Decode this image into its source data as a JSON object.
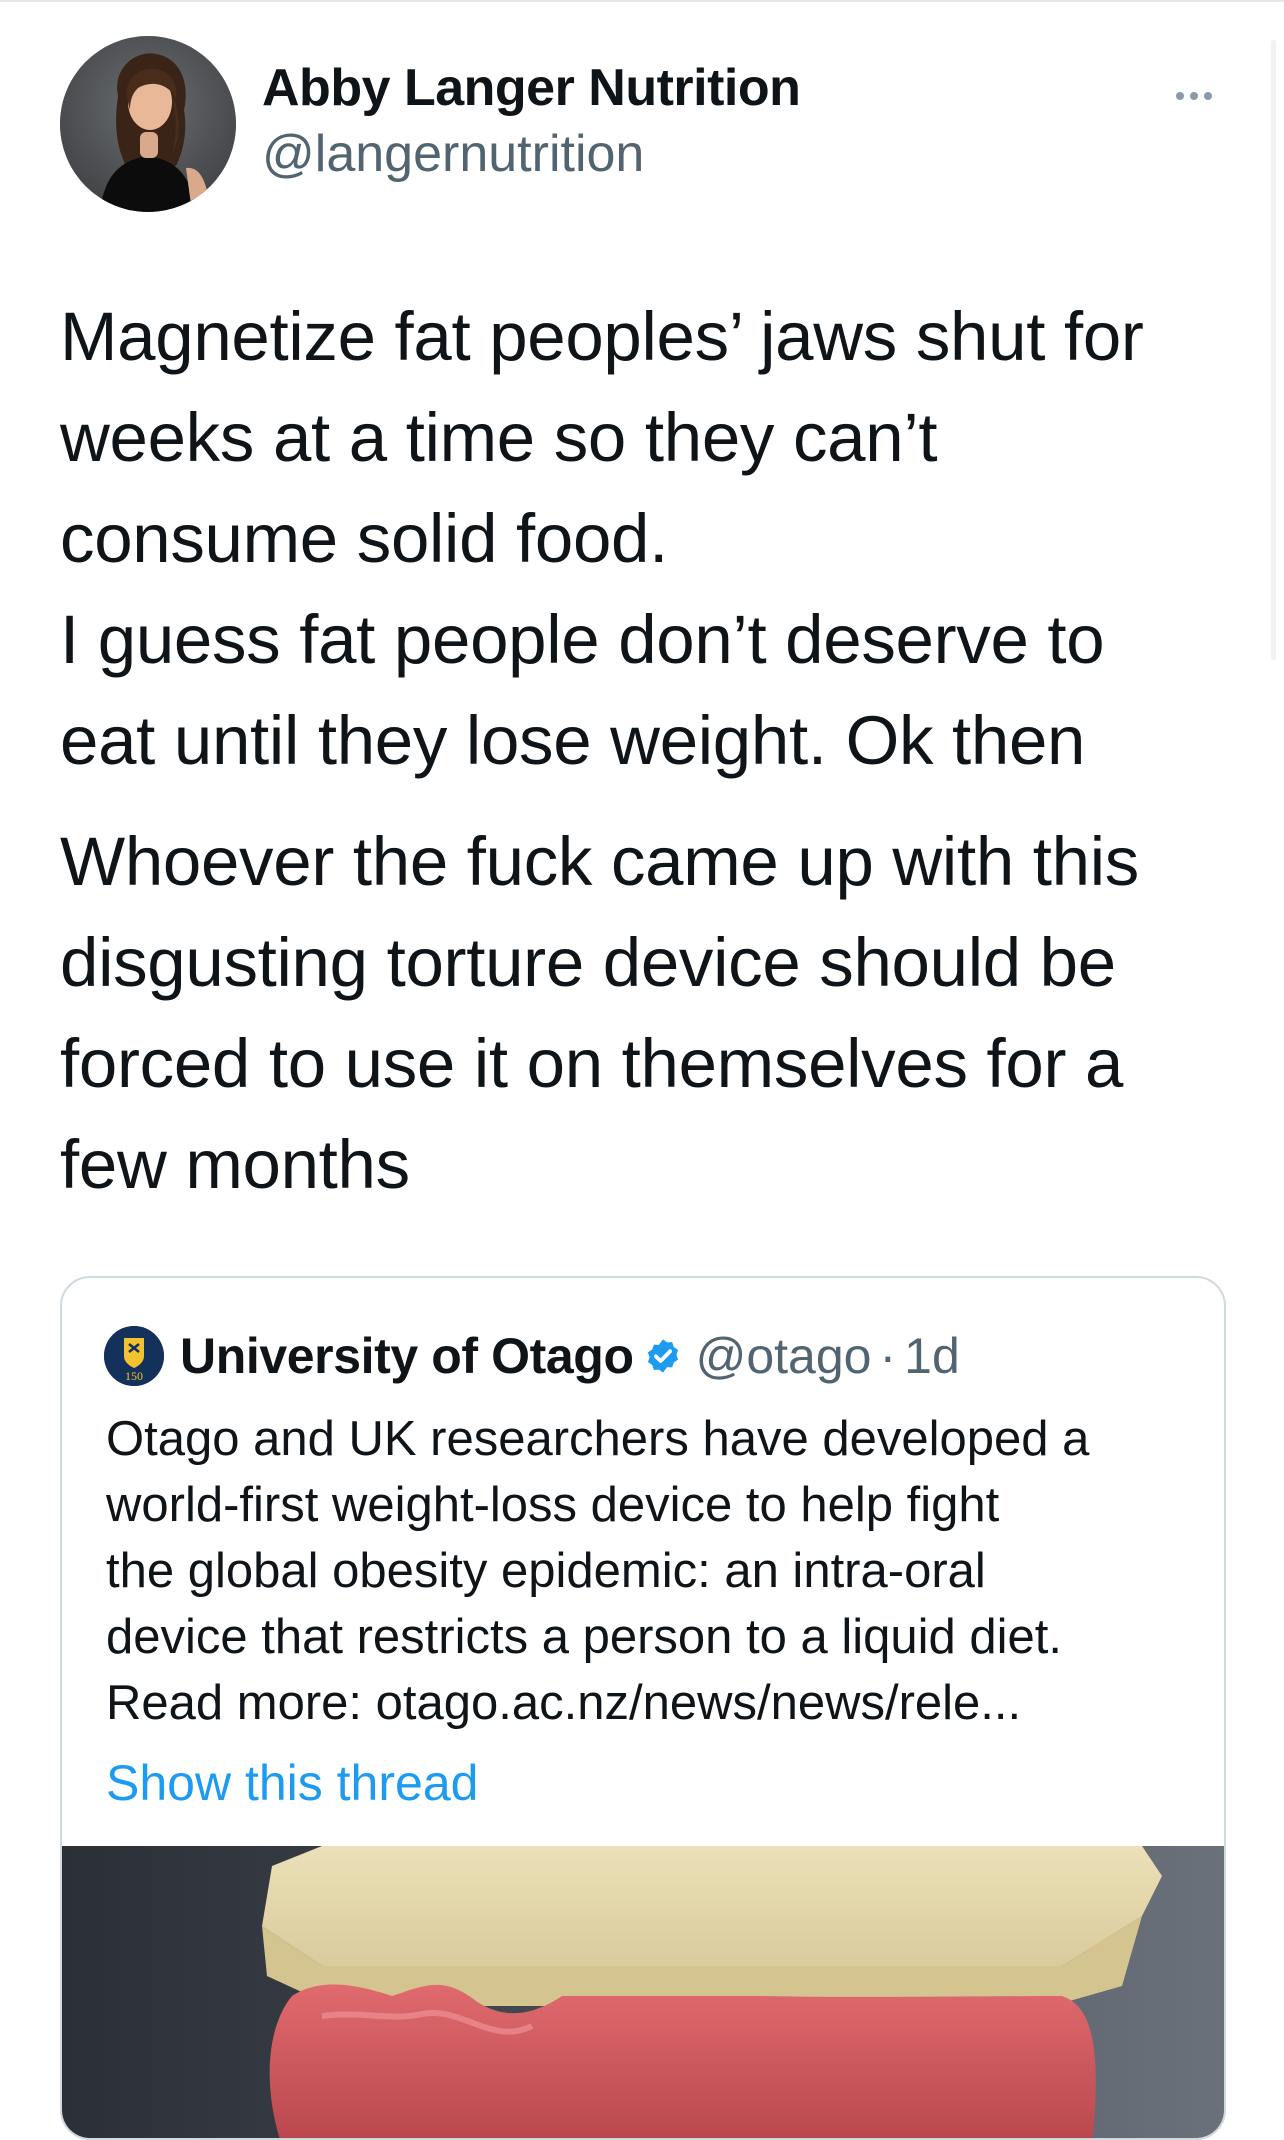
{
  "author": {
    "name": "Abby Langer Nutrition",
    "handle": "@langernutrition"
  },
  "tweet": {
    "paragraph1_lines": [
      "Magnetize fat peoples’ jaws shut for",
      "weeks at a time so they can’t",
      "consume solid food.",
      "I guess fat people don’t deserve to",
      "eat until they lose weight. Ok then"
    ],
    "paragraph2_lines": [
      "Whoever the fuck came up with this",
      "disgusting torture device should be",
      "forced to use it on themselves for a",
      "few months"
    ]
  },
  "quoted_tweet": {
    "name": "University of Otago",
    "avatar_badge": "150",
    "handle": "@otago",
    "separator": "·",
    "time": "1d",
    "text_lines": [
      "Otago and UK researchers have developed a",
      "world-first weight-loss device to help fight",
      "the global obesity epidemic: an intra-oral",
      "device that restricts a person to a liquid diet.",
      "Read more:  otago.ac.nz/news/news/rele..."
    ],
    "show_thread_label": "Show this thread"
  },
  "colors": {
    "text_primary": "#0f1419",
    "text_secondary": "#536471",
    "link": "#1d9bf0",
    "verified": "#1d9bf0",
    "border": "#cfd9de"
  },
  "icons": {
    "more": "more-horizontal-icon",
    "verified": "verified-badge-icon"
  }
}
